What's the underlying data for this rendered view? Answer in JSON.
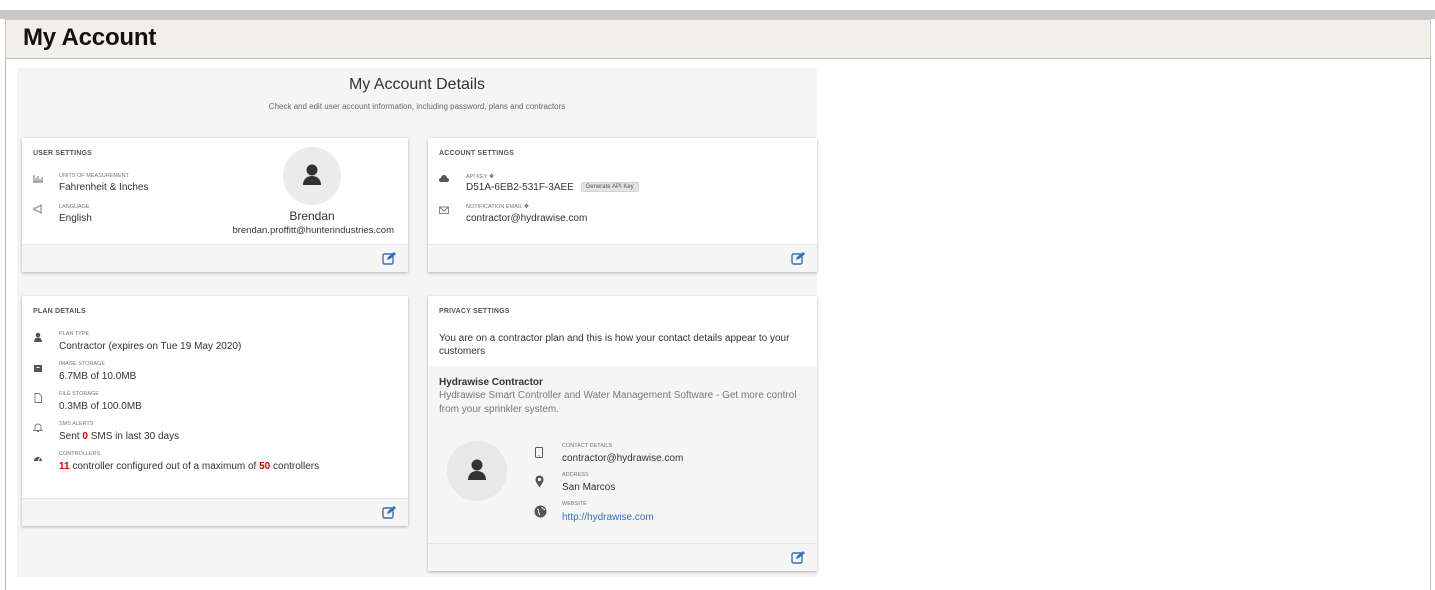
{
  "header": {
    "title": "My Account"
  },
  "panel": {
    "title": "My Account Details",
    "subtitle": "Check and edit user account information, including password, plans and contractors"
  },
  "user_settings": {
    "title": "USER SETTINGS",
    "units_label": "UNITS OF MEASUREMENT",
    "units_value": "Fahrenheit & Inches",
    "language_label": "LANGUAGE",
    "language_value": "English",
    "user_name": "Brendan",
    "user_email": "brendan.proffitt@hunterindustries.com"
  },
  "account_settings": {
    "title": "ACCOUNT SETTINGS",
    "api_key_label": "API KEY",
    "api_key_value": "D51A-6EB2-531F-3AEE",
    "generate_label": "Generate API Key",
    "email_label": "NOTIFICATION EMAIL",
    "email_value": "contractor@hydrawise.com"
  },
  "plan_details": {
    "title": "PLAN DETAILS",
    "plan_label": "PLAN TYPE",
    "plan_value": "Contractor (expires on Tue 19 May 2020)",
    "image_label": "IMAGE STORAGE",
    "image_value": "6.7MB of 10.0MB",
    "file_label": "FILE STORAGE",
    "file_value": "0.3MB of 100.0MB",
    "sms_label": "SMS ALERTS",
    "sms_pre": "Sent ",
    "sms_count": "0",
    "sms_post": " SMS in last 30 days",
    "ctrl_label": "CONTROLLERS",
    "ctrl_count": "11",
    "ctrl_mid": " controller configured out of a maximum of ",
    "ctrl_max": "50",
    "ctrl_post": " controllers"
  },
  "privacy": {
    "title": "PRIVACY SETTINGS",
    "intro": "You are on a contractor plan and this is how your contact details appear to your customers",
    "company_name": "Hydrawise Contractor",
    "company_desc": "Hydrawise Smart Controller and Water Management Software - Get more control from your sprinkler system.",
    "contact_label": "CONTACT DETAILS",
    "contact_value": "contractor@hydrawise.com",
    "address_label": "ADDRESS",
    "address_value": "San Marcos",
    "website_label": "WEBSITE",
    "website_value": "http://hydrawise.com"
  },
  "icons": {
    "accent": "#3a6fb5",
    "edit": "edit-icon"
  }
}
